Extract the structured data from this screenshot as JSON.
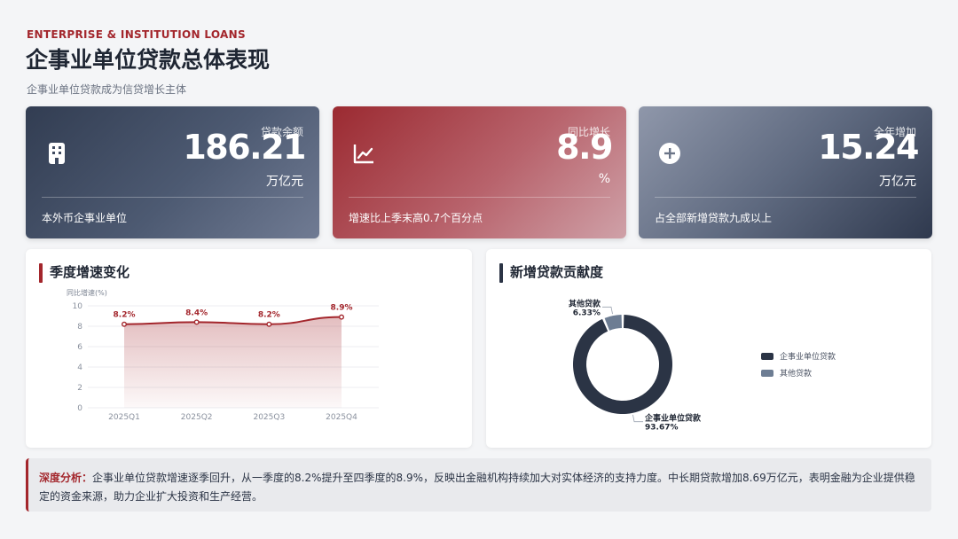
{
  "header": {
    "eyebrow": "ENTERPRISE & INSTITUTION LOANS",
    "title": "企事业单位贷款总体表现",
    "subtitle": "企事业单位贷款成为信贷增长主体"
  },
  "cards": [
    {
      "label": "贷款余额",
      "value": "186.21",
      "unit": "万亿元",
      "note": "本外币企事业单位",
      "icon": "building-icon"
    },
    {
      "label": "同比增长",
      "value": "8.9",
      "unit": "%",
      "note": "增速比上季末高0.7个百分点",
      "icon": "line-chart-icon"
    },
    {
      "label": "全年增加",
      "value": "15.24",
      "unit": "万亿元",
      "note": "占全部新增贷款九成以上",
      "icon": "plus-circle-icon"
    }
  ],
  "panels": {
    "growth_title": "季度增速变化",
    "share_title": "新增贷款贡献度"
  },
  "chart_data": [
    {
      "type": "area",
      "categories": [
        "2025Q1",
        "2025Q2",
        "2025Q3",
        "2025Q4"
      ],
      "values": [
        8.2,
        8.4,
        8.2,
        8.9
      ],
      "data_labels": [
        "8.2%",
        "8.4%",
        "8.2%",
        "8.9%"
      ],
      "ylabel": "同比增速(%)",
      "ylim": [
        0,
        10
      ],
      "yticks": [
        "0",
        "2",
        "4",
        "6",
        "8",
        "10"
      ],
      "grid": true,
      "color": "#a3262c"
    },
    {
      "type": "pie",
      "donut": true,
      "series": [
        {
          "name": "企事业单位贷款",
          "value": 93.67,
          "label": "93.67%",
          "color": "#2b3445"
        },
        {
          "name": "其他贷款",
          "value": 6.33,
          "label": "6.33%",
          "color": "#6d7d93"
        }
      ],
      "legend": "right"
    }
  ],
  "analysis": {
    "lead": "深度分析：",
    "text": "企事业单位贷款增速逐季回升，从一季度的8.2%提升至四季度的8.9%，反映出金融机构持续加大对实体经济的支持力度。中长期贷款增加8.69万亿元，表明金融为企业提供稳定的资金来源，助力企业扩大投资和生产经营。"
  }
}
